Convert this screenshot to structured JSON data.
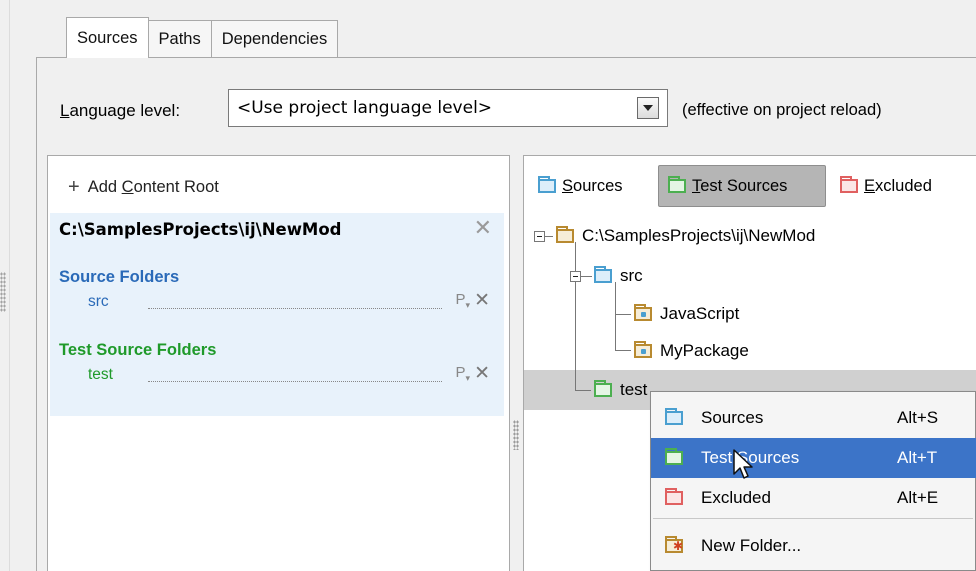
{
  "tabs": [
    {
      "label": "Sources",
      "active": true
    },
    {
      "label": "Paths",
      "active": false
    },
    {
      "label": "Dependencies",
      "active": false
    }
  ],
  "language_level": {
    "label_mnemonic": "L",
    "label_rest": "anguage level:",
    "selected": "<Use project language level>",
    "note": "(effective on project reload)"
  },
  "left_pane": {
    "add_plus": "+",
    "add_before": "Add ",
    "add_mnemonic": "C",
    "add_after": "ontent Root",
    "root_path": "C:\\SamplesProjects\\ij\\NewMod",
    "source_folders_title": "Source Folders",
    "source_folders": [
      "src"
    ],
    "test_source_folders_title": "Test Source Folders",
    "test_source_folders": [
      "test"
    ],
    "prefix_button": "P",
    "remove_glyph": "✕"
  },
  "toolbar": {
    "sources": {
      "mnemonic": "S",
      "rest": "ources"
    },
    "test_sources": {
      "mnemonic": "T",
      "rest": "est Sources",
      "selected": true
    },
    "excluded": {
      "mnemonic": "E",
      "rest": "xcluded"
    }
  },
  "tree": [
    {
      "label": "C:\\SamplesProjects\\ij\\NewMod",
      "icon": "tan-folder-icon"
    },
    {
      "label": "src",
      "icon": "blue-folder-icon"
    },
    {
      "label": "JavaScript",
      "icon": "package-folder-icon"
    },
    {
      "label": "MyPackage",
      "icon": "package-folder-icon"
    },
    {
      "label": "test",
      "icon": "green-folder-icon",
      "selected": true
    }
  ],
  "context_menu": [
    {
      "label": "Sources",
      "shortcut": "Alt+S",
      "icon": "blue-folder-icon"
    },
    {
      "label": "Test Sources",
      "shortcut": "Alt+T",
      "icon": "green-folder-icon",
      "highlighted": true
    },
    {
      "label": "Excluded",
      "shortcut": "Alt+E",
      "icon": "red-folder-icon"
    },
    {
      "label": "New Folder...",
      "shortcut": "",
      "icon": "new-folder-icon"
    }
  ],
  "colors": {
    "source_blue": "#2a6ab8",
    "test_green": "#1f9a2a",
    "menu_highlight": "#3c74c8",
    "root_block_bg": "#e8f2fb"
  }
}
